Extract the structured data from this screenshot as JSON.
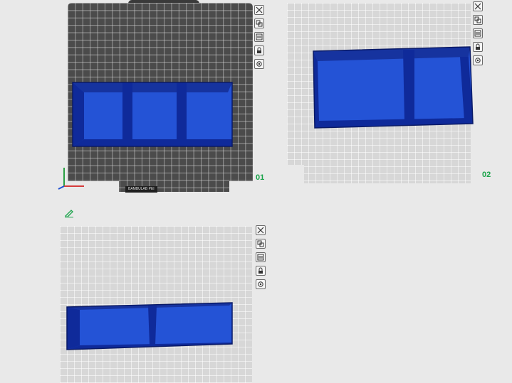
{
  "plates": [
    {
      "number": "01",
      "theme": "textured-dark",
      "bed_label": "BAMBULAB PEI"
    },
    {
      "number": "02",
      "theme": "light"
    },
    {
      "number": "",
      "theme": "light"
    }
  ],
  "toolbar_icons": [
    "close-icon",
    "arrange-icon",
    "orient-icon",
    "lock-icon",
    "settings-icon"
  ],
  "colors": {
    "object_top": "#2453d6",
    "object_side": "#0f2a9a",
    "object_edge": "#0a1a66",
    "plate_number": "#1aa34a",
    "dark_plate": "#4b4b4b",
    "light_plate": "#d7d7d7"
  },
  "edit_icon": "pencil-icon"
}
